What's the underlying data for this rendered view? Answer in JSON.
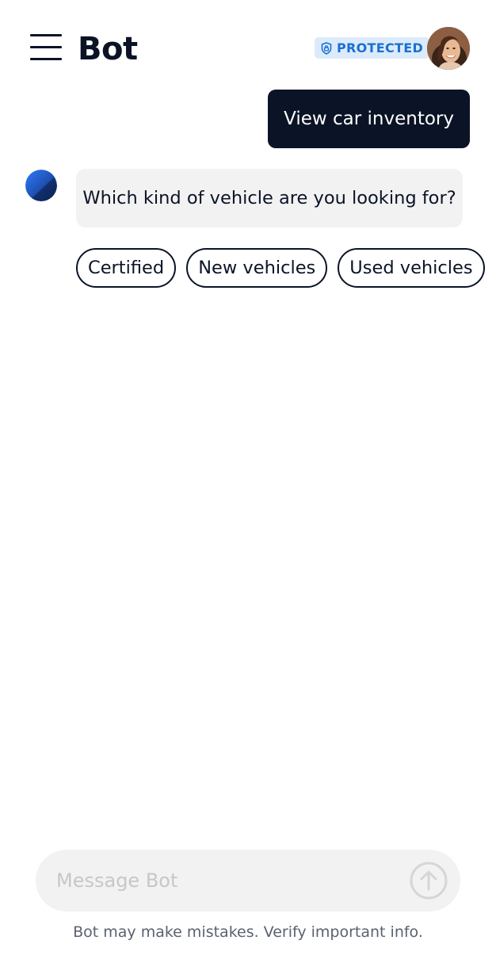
{
  "header": {
    "title": "Bot",
    "badge": {
      "label": "PROTECTED",
      "icon": "shield-lock-icon"
    },
    "menu_icon": "hamburger-menu-icon",
    "avatar": "user-avatar-photo"
  },
  "conversation": {
    "user_message": "View car inventory",
    "bot_message": "Which kind of vehicle are you looking for?",
    "quick_replies": [
      "Certified",
      "New vehicles",
      "Used vehicles"
    ]
  },
  "composer": {
    "placeholder": "Message Bot",
    "value": "",
    "send_icon": "arrow-up-circle-icon"
  },
  "footer": {
    "disclaimer": "Bot may make mistakes. Verify important info."
  },
  "colors": {
    "primary": "#0b1426",
    "badge_bg": "#dcebfb",
    "badge_text": "#1b6fd0",
    "bubble_bg": "#f2f2f2",
    "bot_avatar_blue": "#1e5bd8"
  }
}
